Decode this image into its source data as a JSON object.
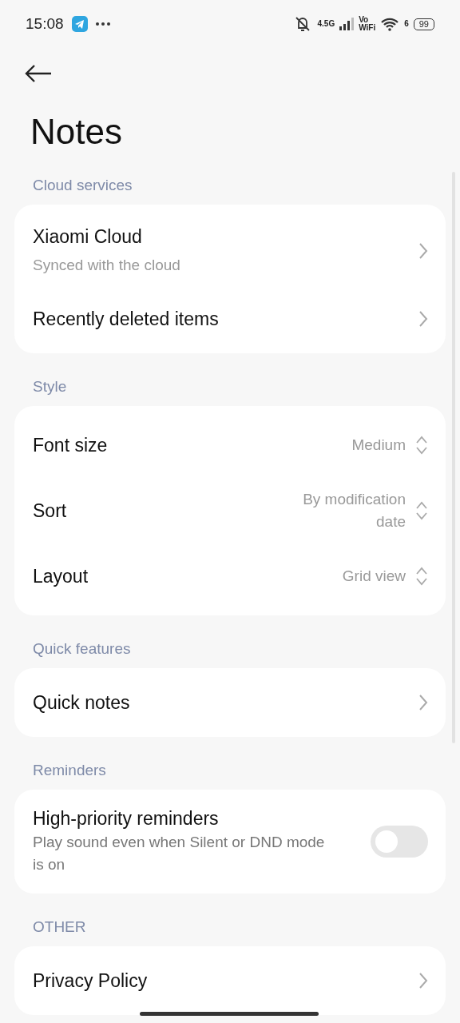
{
  "status_bar": {
    "time": "15:08",
    "network": "4.5G",
    "vo": "Vo",
    "wifi_label": "WiFi",
    "wifi_band": "6",
    "battery": "99"
  },
  "title": "Notes",
  "sections": [
    {
      "header": "Cloud services",
      "items": [
        {
          "kind": "link",
          "label": "Xiaomi Cloud",
          "sub": "Synced with the cloud"
        },
        {
          "kind": "link",
          "label": "Recently deleted items"
        }
      ]
    },
    {
      "header": "Style",
      "items": [
        {
          "kind": "select",
          "label": "Font size",
          "value": "Medium"
        },
        {
          "kind": "select",
          "label": "Sort",
          "value": "By modification date"
        },
        {
          "kind": "select",
          "label": "Layout",
          "value": "Grid view"
        }
      ]
    },
    {
      "header": "Quick features",
      "items": [
        {
          "kind": "link",
          "label": "Quick notes"
        }
      ]
    },
    {
      "header": "Reminders",
      "items": [
        {
          "kind": "toggle",
          "label": "High-priority reminders",
          "description": "Play sound even when Silent or DND mode is on",
          "on": false
        }
      ]
    },
    {
      "header": "OTHER",
      "items": [
        {
          "kind": "link",
          "label": "Privacy Policy"
        }
      ]
    }
  ]
}
